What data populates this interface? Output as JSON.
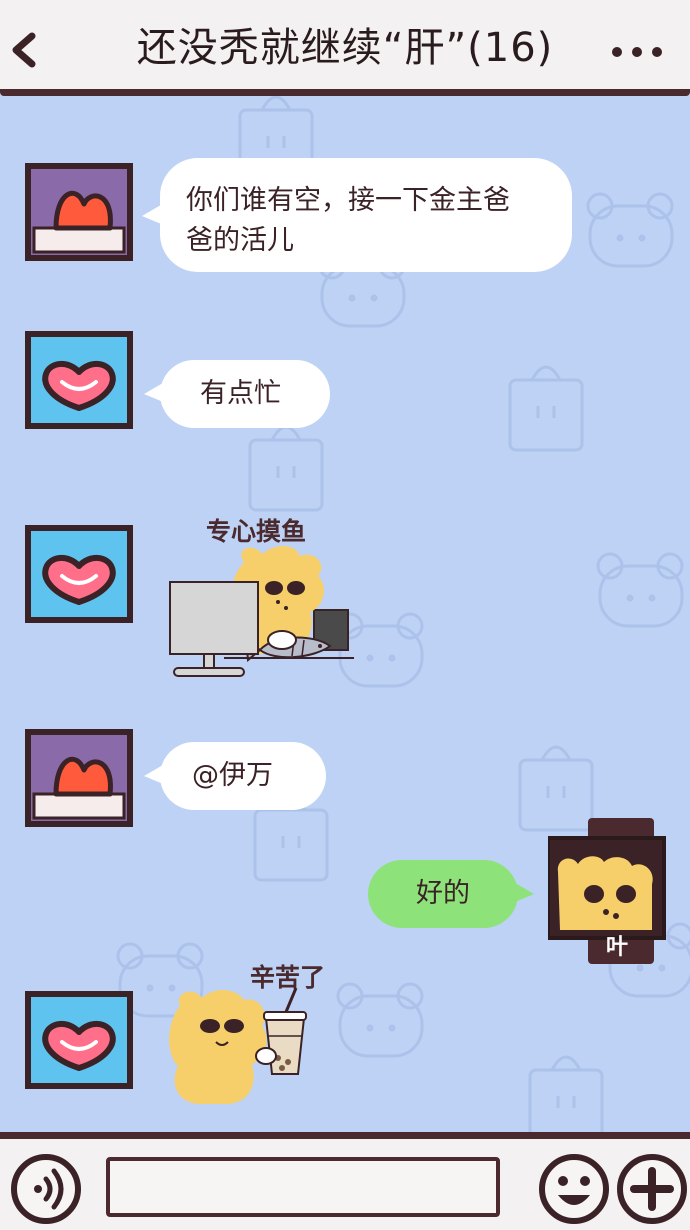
{
  "header": {
    "title": "还没秃就继续“肝”(16)",
    "back_icon": "back-chevron-icon",
    "more_icon": "more-dots-icon"
  },
  "messages": [
    {
      "sender": "purple-avatar",
      "side": "left",
      "type": "text",
      "text_line1": "你们谁有空，接一下金主爸",
      "text_line2": "爸的活儿"
    },
    {
      "sender": "blue-avatar",
      "side": "left",
      "type": "text",
      "text": "有点忙"
    },
    {
      "sender": "blue-avatar",
      "side": "left",
      "type": "sticker",
      "caption": "专心摸鱼"
    },
    {
      "sender": "purple-avatar",
      "side": "left",
      "type": "text",
      "text": "@伊万"
    },
    {
      "sender": "bear-avatar",
      "side": "right",
      "type": "text",
      "text": "好的",
      "avatar_label": "叶"
    },
    {
      "sender": "blue-avatar",
      "side": "left",
      "type": "sticker",
      "caption": "辛苦了"
    }
  ],
  "footer": {
    "input_value": "",
    "voice_icon": "voice-icon",
    "emoji_icon": "emoji-icon",
    "plus_icon": "plus-icon"
  },
  "colors": {
    "background": "#bdd2f4",
    "outline": "#4a2a2e",
    "bubble_self": "#8de37a",
    "bubble_other": "#ffffff",
    "avatar_purple": "#8a6aa8",
    "avatar_blue": "#5ec3ef",
    "bear": "#f6cf6b"
  }
}
